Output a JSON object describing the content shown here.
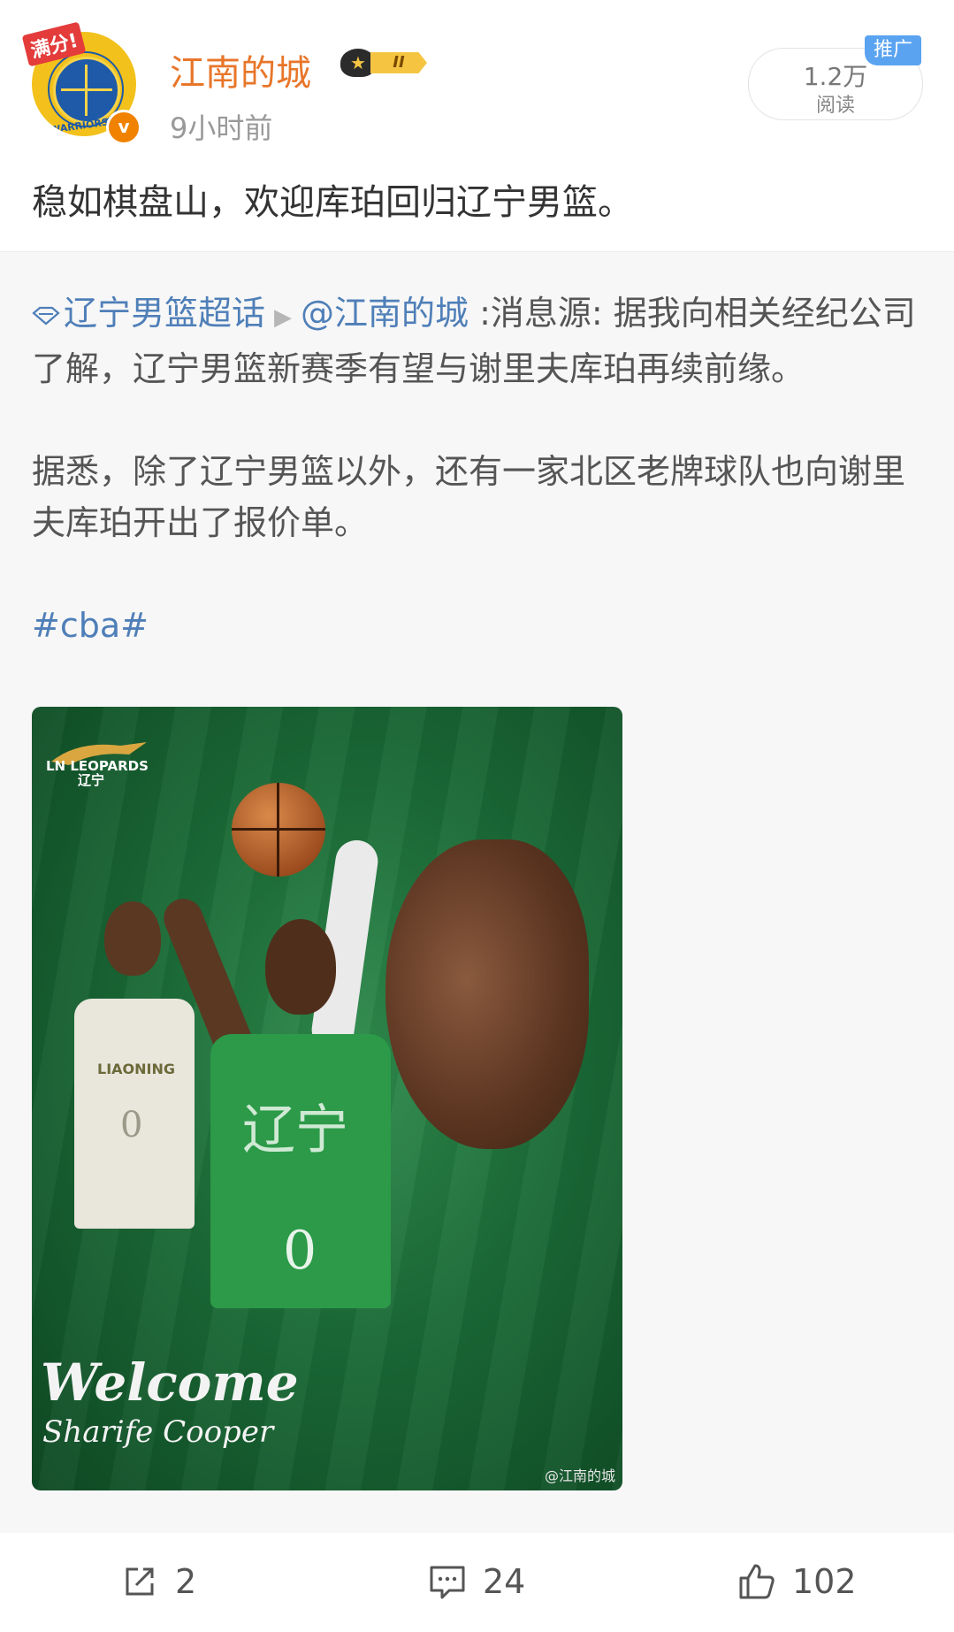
{
  "post": {
    "avatar_badge": "满分!",
    "avatar_ring_text": "WARRIORS",
    "username": "江南的城",
    "vip_level": "II",
    "time": "9小时前",
    "reads_count": "1.2万",
    "reads_label": "阅读",
    "promo_tag": "推广",
    "text": "稳如棋盘山，欢迎库珀回归辽宁男篮。"
  },
  "repost": {
    "topic": "辽宁男篮超话",
    "mention": "@江南的城",
    "para1_rest": " :消息源: 据我向相关经纪公司了解，辽宁男篮新赛季有望与谢里夫库珀再续前缘。",
    "para2": "据悉，除了辽宁男篮以外，还有一家北区老牌球队也向谢里夫库珀开出了报价单。",
    "hashtag": "#cba#",
    "image": {
      "team_logo_text": "LN LEOPARDS",
      "team_logo_sub": "辽宁",
      "left_jersey_text": "LIAONING",
      "jersey_number": "0",
      "main_jersey_text": "辽宁",
      "welcome": "Welcome",
      "player_name": "Sharife Cooper",
      "watermark": "@江南的城"
    }
  },
  "actions": {
    "share_count": "2",
    "comment_count": "24",
    "like_count": "102"
  },
  "colors": {
    "username": "#e8762a",
    "link": "#4f7fb8",
    "promo": "#5aa3f0",
    "repost_bg": "#f7f7f7"
  }
}
